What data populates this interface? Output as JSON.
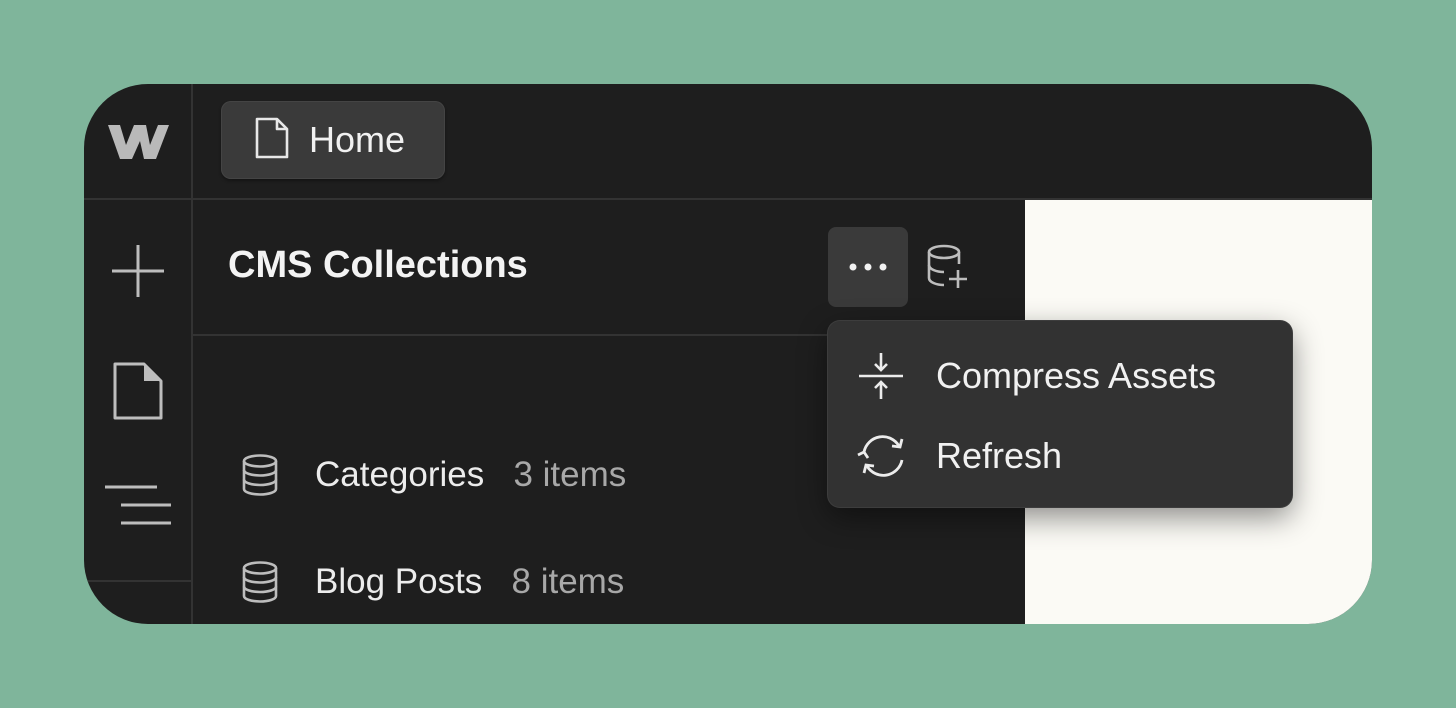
{
  "topbar": {
    "active_tab": {
      "label": "Home",
      "icon": "page-icon"
    }
  },
  "rail": {
    "logo": "webflow-logo",
    "items": [
      {
        "name": "add",
        "icon": "plus-icon"
      },
      {
        "name": "pages",
        "icon": "page-icon"
      },
      {
        "name": "navigator",
        "icon": "navigator-icon"
      }
    ]
  },
  "panel": {
    "title": "CMS Collections",
    "more_icon": "ellipsis-icon",
    "add_icon": "database-plus-icon",
    "collections": [
      {
        "name": "Categories",
        "count": "3 items",
        "icon": "database-icon"
      },
      {
        "name": "Blog Posts",
        "count": "8 items",
        "icon": "database-icon"
      }
    ]
  },
  "menu": {
    "items": [
      {
        "label": "Compress Assets",
        "icon": "compress-icon"
      },
      {
        "label": "Refresh",
        "icon": "refresh-icon"
      }
    ]
  },
  "colors": {
    "background": "#7fb59b",
    "panel": "#1e1e1e",
    "canvas": "#fbfaf5",
    "menu": "#323232"
  }
}
